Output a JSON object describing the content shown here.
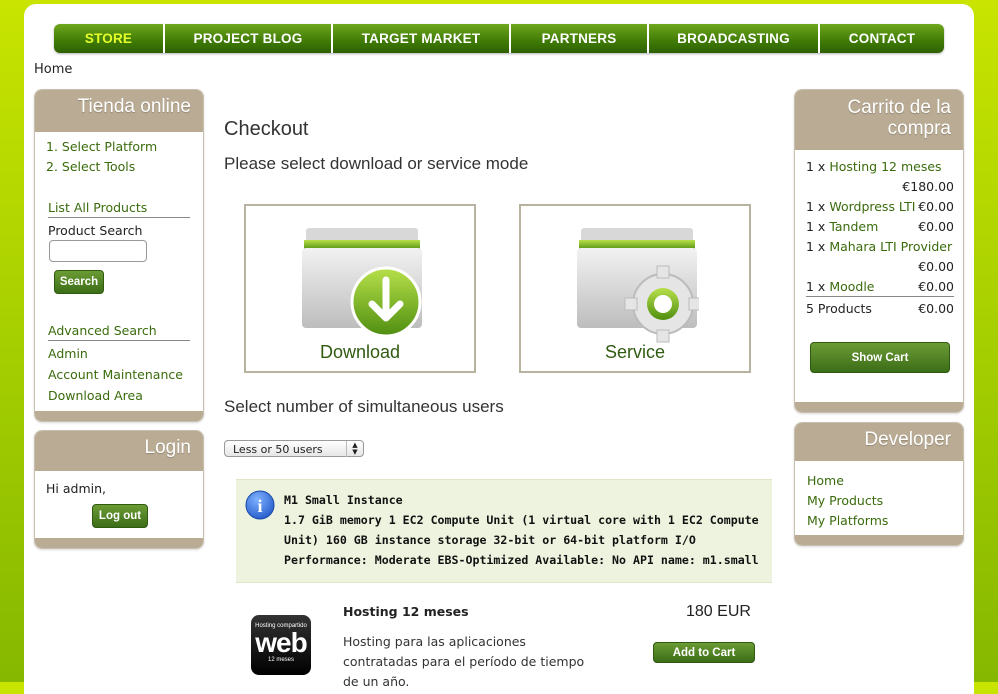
{
  "nav": [
    {
      "label": "STORE",
      "active": true
    },
    {
      "label": "PROJECT BLOG"
    },
    {
      "label": "TARGET MARKET"
    },
    {
      "label": "PARTNERS"
    },
    {
      "label": "BROADCASTING"
    },
    {
      "label": "CONTACT"
    }
  ],
  "breadcrumb": "Home",
  "tienda": {
    "title": "Tienda online",
    "steps": [
      "1. Select Platform",
      "2. Select Tools"
    ],
    "list_all": "List All Products",
    "product_search_label": "Product Search",
    "search_value": "",
    "search_button": "Search",
    "advanced_search": "Advanced Search",
    "links": [
      "Admin",
      "Account Maintenance",
      "Download Area"
    ]
  },
  "login": {
    "title": "Login",
    "greeting": "Hi admin,",
    "logout_button": "Log out"
  },
  "main": {
    "title": "Checkout",
    "subtitle": "Please select download or service mode",
    "download_label": "Download",
    "service_label": "Service",
    "users_heading": "Select number of simultaneous users",
    "users_select": "Less or 50 users",
    "instance_name": "M1 Small Instance",
    "instance_desc": "1.7 GiB memory 1 EC2 Compute Unit (1 virtual core with 1 EC2 Compute Unit) 160 GB instance storage 32-bit or 64-bit platform I/O Performance: Moderate EBS-Optimized Available: No API name: m1.small",
    "product_logo_top": "Hosting compartido",
    "product_logo_main": "web",
    "product_logo_bottom": "12 meses",
    "product_title": "Hosting 12 meses",
    "product_desc": "Hosting para las aplicaciones contratadas para el período de tiempo de un año.",
    "product_price": "180 EUR",
    "add_to_cart": "Add to Cart"
  },
  "cart": {
    "title": "Carrito de la compra",
    "items": [
      {
        "qty": "1 x",
        "name": "Hosting 12 meses",
        "price": ""
      },
      {
        "qty": "",
        "name": "",
        "price": "€180.00"
      },
      {
        "qty": "1 x",
        "name": "Wordpress LTI",
        "price": "€0.00"
      },
      {
        "qty": "1 x",
        "name": "Tandem",
        "price": "€0.00"
      },
      {
        "qty": "1 x",
        "name": "Mahara LTI Provider",
        "price": ""
      },
      {
        "qty": "",
        "name": "",
        "price": "€0.00"
      },
      {
        "qty": "1 x",
        "name": "Moodle",
        "price": "€0.00"
      }
    ],
    "total_label": "5 Products",
    "total_price": "€0.00",
    "show_cart": "Show Cart"
  },
  "developer": {
    "title": "Developer",
    "links": [
      "Home",
      "My Products",
      "My Platforms"
    ]
  },
  "colors": {
    "accent_green": "#3c6d18",
    "box_header": "#b9ab94",
    "nav_active": "#e6ff2a"
  }
}
